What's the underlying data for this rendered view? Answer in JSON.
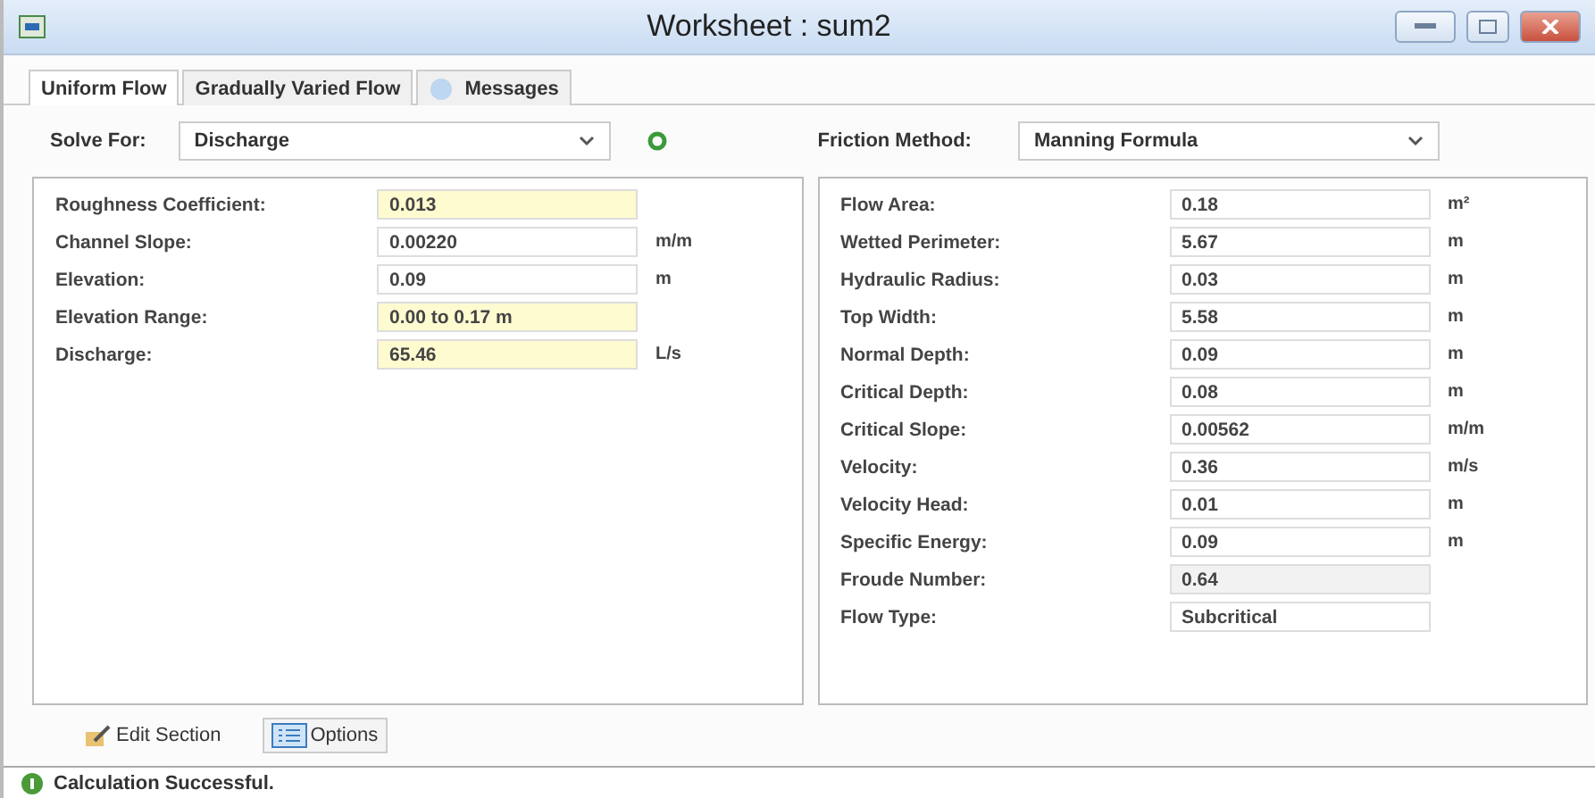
{
  "window": {
    "title": "Worksheet : sum2"
  },
  "tabs": [
    {
      "label": "Uniform Flow",
      "selected": true
    },
    {
      "label": "Gradually Varied Flow",
      "selected": false
    },
    {
      "label": "Messages",
      "selected": false
    }
  ],
  "solve_for": {
    "label": "Solve For:",
    "value": "Discharge"
  },
  "friction_method": {
    "label": "Friction Method:",
    "value": "Manning Formula"
  },
  "inputs": [
    {
      "label": "Roughness Coefficient:",
      "value": "0.013",
      "kind": "input"
    },
    {
      "label": "Channel Slope:",
      "value": "0.00220",
      "unit": "m/m",
      "kind": "output"
    },
    {
      "label": "Elevation:",
      "value": "0.09",
      "unit": "m",
      "kind": "output"
    },
    {
      "label": "Elevation Range:",
      "value": "0.00 to 0.17 m",
      "kind": "input"
    },
    {
      "label": "Discharge:",
      "value": "65.46",
      "unit": "L/s",
      "kind": "input"
    }
  ],
  "results": [
    {
      "label": "Flow Area:",
      "value": "0.18",
      "unit": "m²",
      "kind": "output"
    },
    {
      "label": "Wetted Perimeter:",
      "value": "5.67",
      "unit": "m",
      "kind": "output"
    },
    {
      "label": "Hydraulic Radius:",
      "value": "0.03",
      "unit": "m",
      "kind": "output"
    },
    {
      "label": "Top Width:",
      "value": "5.58",
      "unit": "m",
      "kind": "output"
    },
    {
      "label": "Normal Depth:",
      "value": "0.09",
      "unit": "m",
      "kind": "output"
    },
    {
      "label": "Critical Depth:",
      "value": "0.08",
      "unit": "m",
      "kind": "output"
    },
    {
      "label": "Critical Slope:",
      "value": "0.00562",
      "unit": "m/m",
      "kind": "output"
    },
    {
      "label": "Velocity:",
      "value": "0.36",
      "unit": "m/s",
      "kind": "output"
    },
    {
      "label": "Velocity Head:",
      "value": "0.01",
      "unit": "m",
      "kind": "output"
    },
    {
      "label": "Specific Energy:",
      "value": "0.09",
      "unit": "m",
      "kind": "output"
    },
    {
      "label": "Froude Number:",
      "value": "0.64",
      "kind": "readonly"
    },
    {
      "label": "Flow Type:",
      "value": "Subcritical",
      "kind": "output"
    }
  ],
  "bottom_buttons": [
    {
      "label": "Edit Section",
      "selected": false
    },
    {
      "label": "Options",
      "selected": true
    }
  ],
  "status_bar": {
    "text": "Calculation Successful."
  }
}
